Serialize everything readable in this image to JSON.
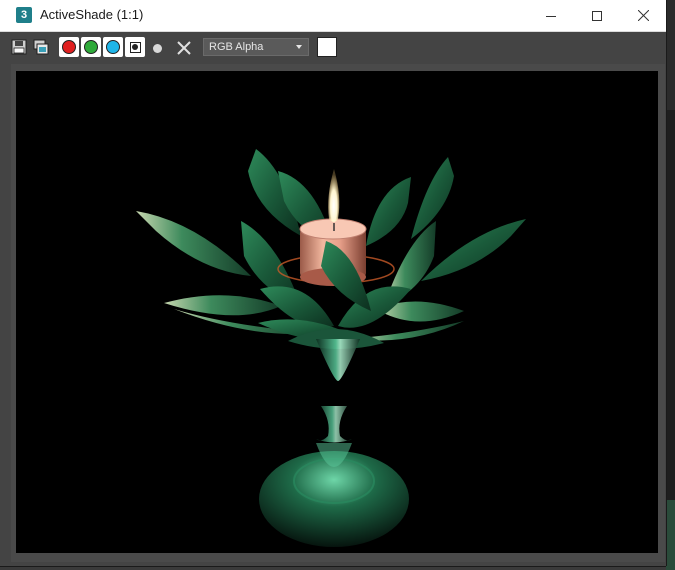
{
  "window": {
    "title": "ActiveShade (1:1)",
    "app_icon_label": "3"
  },
  "toolbar": {
    "channel_display": "RGB Alpha",
    "channel_colors": {
      "red": "#e02020",
      "green": "#2faa3a",
      "blue": "#1fb5e8"
    },
    "background_swatch_color": "#ffffff"
  },
  "icons": {
    "save": "save-icon",
    "clone": "clone-window-icon",
    "red": "red-channel-icon",
    "green": "green-channel-icon",
    "blue": "blue-channel-icon",
    "mono": "monochrome-icon",
    "alpha": "alpha-channel-icon",
    "clear": "clear-icon",
    "minimize": "minimize-icon",
    "maximize": "maximize-icon",
    "close": "close-icon"
  },
  "render": {
    "subject": "lotus candle holder",
    "petal_color": "#1f6b45",
    "candle_color": "#e8a08a",
    "flame_color": "#fff6d0"
  }
}
